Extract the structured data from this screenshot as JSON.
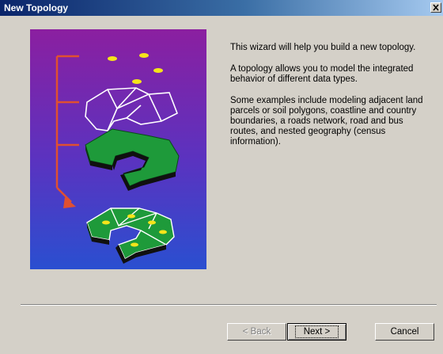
{
  "window": {
    "title": "New Topology",
    "close_glyph": "×"
  },
  "content": {
    "paragraphs": [
      "This wizard will help you build a new topology.",
      "A topology allows you to model the integrated behavior of different data types.",
      "Some examples include modeling adjacent land parcels or soil polygons, coastline and country boundaries, a roads network, road and bus routes, and nested geography (census information)."
    ]
  },
  "buttons": {
    "back": {
      "label": "< Back",
      "enabled": false
    },
    "next": {
      "label": "Next >",
      "default": true
    },
    "cancel": {
      "label": "Cancel"
    }
  },
  "illustration": {
    "icon": "topology-illustration",
    "colors": {
      "background_top": "#8b1fa0",
      "background_bottom": "#2a4fd0",
      "arrow": "#e05030",
      "polygon_fill": "#1e9a3a",
      "point": "#f4e41a",
      "outline": "#ffffff"
    }
  }
}
